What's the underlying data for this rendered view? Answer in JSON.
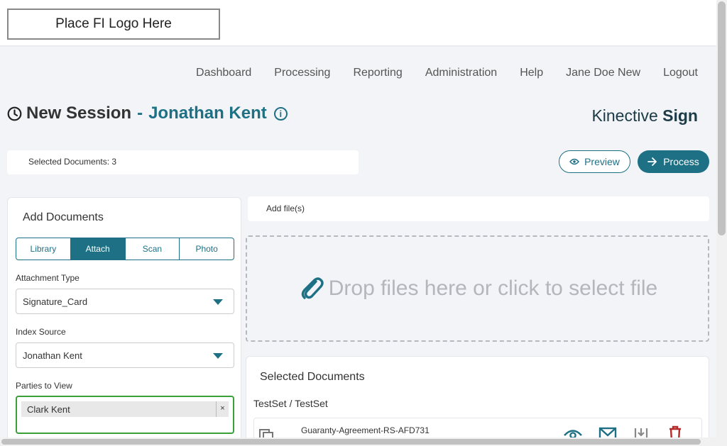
{
  "header": {
    "logo_placeholder": "Place FI Logo Here"
  },
  "nav": {
    "items": [
      "Dashboard",
      "Processing",
      "Reporting",
      "Administration",
      "Help",
      "Jane Doe New",
      "Logout"
    ]
  },
  "session": {
    "title": "New Session",
    "dash": "-",
    "customer_name": "Jonathan Kent",
    "info_icon": "i"
  },
  "brand": {
    "part1": "Kinective",
    "part2": "Sign"
  },
  "selected_documents_bar": "Selected Documents: 3",
  "actions": {
    "preview_label": "Preview",
    "process_label": "Process"
  },
  "add_documents": {
    "title": "Add Documents",
    "tabs": [
      "Library",
      "Attach",
      "Scan",
      "Photo"
    ],
    "active_tab": "Attach",
    "attachment_type_label": "Attachment Type",
    "attachment_type_value": "Signature_Card",
    "index_source_label": "Index Source",
    "index_source_value": "Jonathan Kent",
    "parties_label": "Parties to View",
    "parties": [
      {
        "name": "Clark Kent",
        "remove": "×"
      }
    ]
  },
  "add_files": {
    "label": "Add file(s)",
    "dropzone_text": "Drop files here or click to select file"
  },
  "selected_documents": {
    "title": "Selected Documents",
    "group": "TestSet / TestSet",
    "documents": [
      {
        "name": "Guaranty-Agreement-RS-AFD731"
      }
    ]
  },
  "colors": {
    "accent": "#1e7085",
    "danger": "#b52a2a",
    "valid_border": "#3aa13a"
  }
}
